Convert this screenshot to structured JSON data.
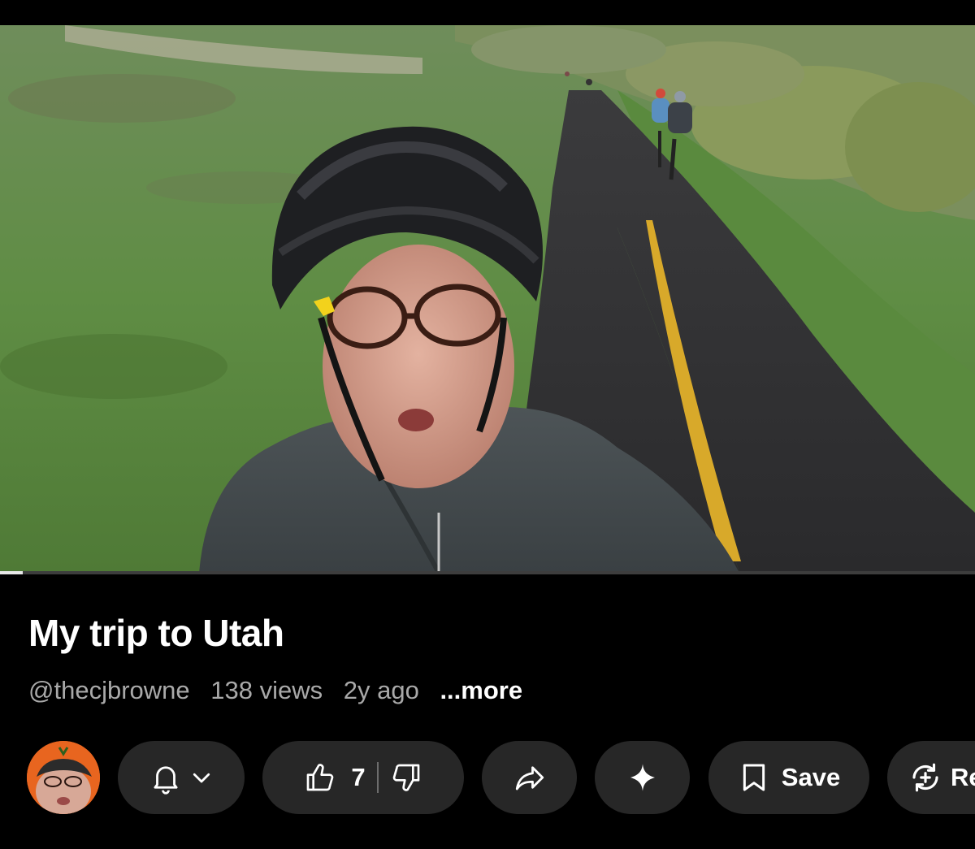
{
  "video": {
    "progress_fraction": 0.023
  },
  "title": "My trip to Utah",
  "meta": {
    "channel": "@thecjbrowne",
    "views": "138 views",
    "age": "2y ago",
    "more": "...more"
  },
  "actions": {
    "like_count": "7",
    "save_label": "Save",
    "remix_label": "Re"
  },
  "icons": {
    "subscribe": "bell-icon",
    "dropdown": "chevron-down-icon",
    "like": "thumbs-up-icon",
    "dislike": "thumbs-down-icon",
    "share": "share-arrow-icon",
    "ask": "sparkle-icon",
    "save": "bookmark-icon",
    "remix": "remix-icon"
  },
  "colors": {
    "background": "#000000",
    "pill": "#272727",
    "meta_text": "#a9a9a9",
    "avatar_bg": "#e8651f"
  }
}
